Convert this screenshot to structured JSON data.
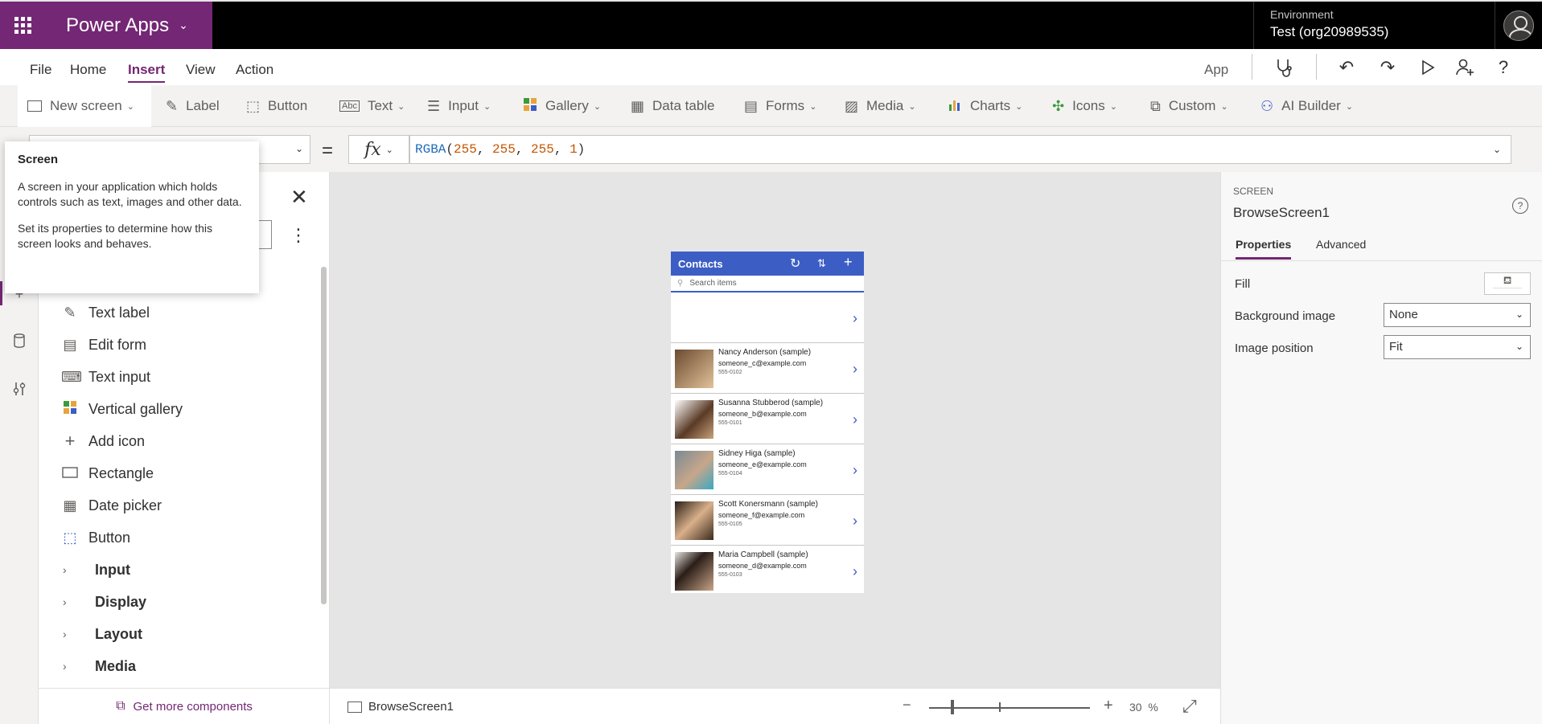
{
  "topbar": {
    "app_title": "Power Apps",
    "environment_label": "Environment",
    "environment_name": "Test (org20989535)"
  },
  "menu": {
    "items": [
      "File",
      "Home",
      "Insert",
      "View",
      "Action"
    ],
    "active": "Insert",
    "app_label": "App"
  },
  "ribbon": {
    "new_screen": "New screen",
    "items": [
      "Label",
      "Button",
      "Text",
      "Input",
      "Gallery",
      "Data table",
      "Forms",
      "Media",
      "Charts",
      "Icons",
      "Custom",
      "AI Builder"
    ]
  },
  "formula_bar": {
    "equals": "=",
    "fx": "fx",
    "func": "RGBA",
    "args": [
      "255",
      "255",
      "255",
      "1"
    ]
  },
  "tooltip": {
    "title": "Screen",
    "paragraph1": "A screen in your application which holds controls such as text, images and other data.",
    "paragraph2": "Set its properties to determine how this screen looks and behaves."
  },
  "insert_panel": {
    "items": [
      "Text label",
      "Edit form",
      "Text input",
      "Vertical gallery",
      "Add icon",
      "Rectangle",
      "Date picker",
      "Button"
    ],
    "groups": [
      "Input",
      "Display",
      "Layout",
      "Media"
    ],
    "footer": "Get more components"
  },
  "phone_app": {
    "title": "Contacts",
    "search_placeholder": "Search items",
    "contacts": [
      {
        "name": "Nancy Anderson (sample)",
        "email": "someone_c@example.com",
        "phone": "555-0102"
      },
      {
        "name": "Susanna Stubberod (sample)",
        "email": "someone_b@example.com",
        "phone": "555-0101"
      },
      {
        "name": "Sidney Higa (sample)",
        "email": "someone_e@example.com",
        "phone": "555-0104"
      },
      {
        "name": "Scott Konersmann (sample)",
        "email": "someone_f@example.com",
        "phone": "555-0105"
      },
      {
        "name": "Maria Campbell (sample)",
        "email": "someone_d@example.com",
        "phone": "555-0103"
      }
    ]
  },
  "statusbar": {
    "screen_name": "BrowseScreen1",
    "zoom_value": "30",
    "zoom_unit": "%"
  },
  "properties_pane": {
    "kind": "SCREEN",
    "name": "BrowseScreen1",
    "tabs": [
      "Properties",
      "Advanced"
    ],
    "fill_label": "Fill",
    "background_image_label": "Background image",
    "background_image_value": "None",
    "image_position_label": "Image position",
    "image_position_value": "Fit"
  },
  "colors": {
    "brand_purple": "#742774",
    "phone_header_blue": "#3c5ec4"
  }
}
